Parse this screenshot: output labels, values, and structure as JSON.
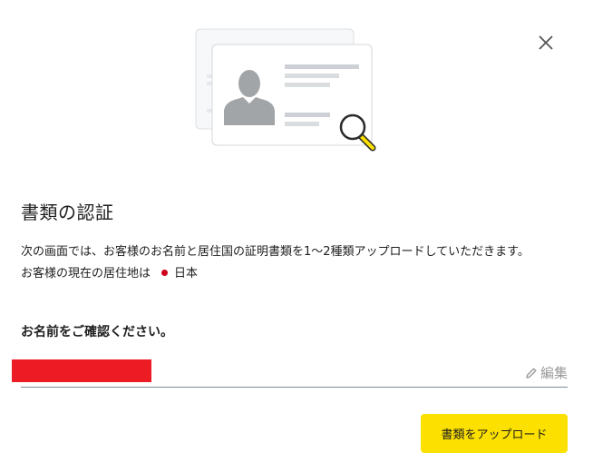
{
  "dialog": {
    "title": "書類の認証",
    "description_line1": "次の画面では、お客様のお名前と居住国の証明書類を1～2種類アップロードしていただきます。",
    "description_line2_prefix": "お客様の現在の居住地は",
    "residence_country": "日本",
    "confirm_name_label": "お名前をご確認ください。",
    "edit_label": "編集",
    "upload_button_label": "書類をアップロード"
  },
  "icons": {
    "close": "close-icon",
    "flag": "japan-flag-icon",
    "edit": "pencil-icon",
    "illustration": "id-card-magnifier-illustration"
  },
  "colors": {
    "accent": "#fce000",
    "redaction": "#ed1c24",
    "flag_red": "#d0021b",
    "muted_text": "#9a9a9a"
  }
}
